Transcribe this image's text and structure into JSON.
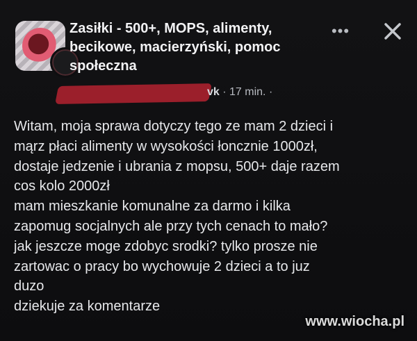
{
  "post": {
    "group_title": "Zasiłki - 500+, MOPS, alimenty, becikowe, macierzyński, pomoc społeczna",
    "author_fragment": "vk",
    "separator": "·",
    "time": "17 min.",
    "trailing_separator": "·",
    "lines": [
      "Witam, moja sprawa dotyczy tego ze mam 2 dzieci i",
      "mąrz płaci alimenty w wysokości łoncznie 1000zł,",
      "dostaje jedzenie i ubrania z mopsu, 500+ daje razem",
      "cos kolo 2000zł",
      "mam mieszkanie komunalne za darmo i kilka",
      "zapomug socjalnych ale przy tych cenach to mało?",
      "jak jeszcze moge zdobyc srodki? tylko prosze nie",
      "zartowac o pracy bo wychowuje 2 dzieci a to juz",
      "duzo",
      "dziekuje za komentarze"
    ]
  },
  "header_actions": {
    "more_glyph": "•••",
    "more_icon": "more-options-icon",
    "close_icon": "close-icon"
  },
  "watermark": "www.wiocha.pl",
  "colors": {
    "background": "#0b0b0c",
    "text": "#e7e8eb",
    "secondary_text": "#b8bbc1",
    "redaction": "#9b1f2b"
  }
}
